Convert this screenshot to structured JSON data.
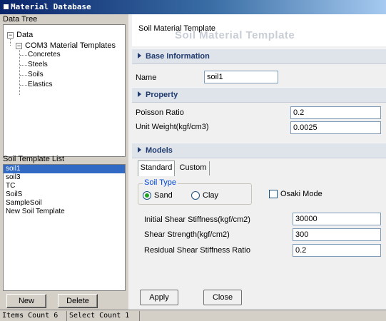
{
  "window": {
    "title": "Material Database"
  },
  "tree": {
    "caption": "Data Tree",
    "root": "Data",
    "group": "COM3 Material Templates",
    "children": [
      "Concretes",
      "Steels",
      "Soils",
      "Elastics"
    ],
    "root_expander": "−",
    "group_expander": "−"
  },
  "template_list": {
    "caption": "Soil Template List",
    "items": [
      "soil1",
      "soil3",
      "TC",
      "SoilS",
      "SampleSoil",
      "New Soil Template"
    ],
    "selected": "soil1"
  },
  "left_buttons": {
    "new": "New",
    "delete": "Delete"
  },
  "header": {
    "title": "Soil Material Template",
    "watermark": "Soil Material Template"
  },
  "sections": {
    "base": "Base Information",
    "property": "Property",
    "models": "Models"
  },
  "base": {
    "name_label": "Name",
    "name_value": "soil1"
  },
  "property": {
    "poisson_label": "Poisson Ratio",
    "poisson_value": "0.2",
    "unit_weight_label": "Unit Weight(kgf/cm3)",
    "unit_weight_value": "0.0025"
  },
  "models": {
    "tabs": [
      "Standard",
      "Custom"
    ],
    "active_tab": "Standard",
    "soil_type_label": "Soil Type",
    "soil_options": [
      "Sand",
      "Clay"
    ],
    "soil_selected": "Sand",
    "osaki_label": "Osaki Mode",
    "osaki_checked": false,
    "initial_shear_label": "Initial Shear Stiffness(kgf/cm2)",
    "initial_shear_value": "30000",
    "shear_strength_label": "Shear Strength(kgf/cm2)",
    "shear_strength_value": "300",
    "residual_label": "Residual Shear Stiffness Ratio",
    "residual_value": "0.2"
  },
  "actions": {
    "apply": "Apply",
    "close": "Close"
  },
  "status": {
    "items_count": "Items Count 6",
    "select_count": "Select Count 1"
  },
  "colors": {
    "title_start": "#0a246a",
    "selection": "#316ac5",
    "section_bg": "#dfe3ea",
    "legend": "#0046d5"
  }
}
